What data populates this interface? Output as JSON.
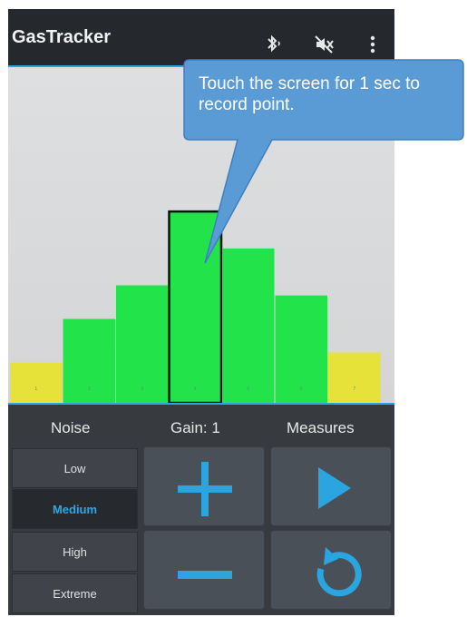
{
  "app": {
    "title": "GasTracker",
    "icons": [
      "bluetooth-icon",
      "mute-icon",
      "overflow-menu-icon"
    ]
  },
  "chart_data": {
    "type": "bar",
    "categories": [
      "1",
      "2",
      "3",
      "4",
      "5",
      "6",
      "7"
    ],
    "values": [
      12,
      25,
      35,
      57,
      46,
      32,
      15
    ],
    "colors": [
      "#e6e23a",
      "#22e34a",
      "#22e34a",
      "#22e34a",
      "#22e34a",
      "#22e34a",
      "#e6e23a"
    ],
    "highlighted_index": 3,
    "ylim": [
      0,
      100
    ]
  },
  "panel": {
    "noise_label": "Noise",
    "gain_label": "Gain: 1",
    "measures_label": "Measures",
    "noise_options": [
      "Low",
      "Medium",
      "High",
      "Extreme"
    ],
    "selected_noise": "Medium"
  },
  "callout": {
    "text": "Touch the screen for 1 sec to record point."
  },
  "colors": {
    "accent": "#2aa5e0",
    "callout_fill": "#5b9bd5",
    "bar_green": "#22e34a",
    "bar_yellow": "#e6e23a"
  }
}
